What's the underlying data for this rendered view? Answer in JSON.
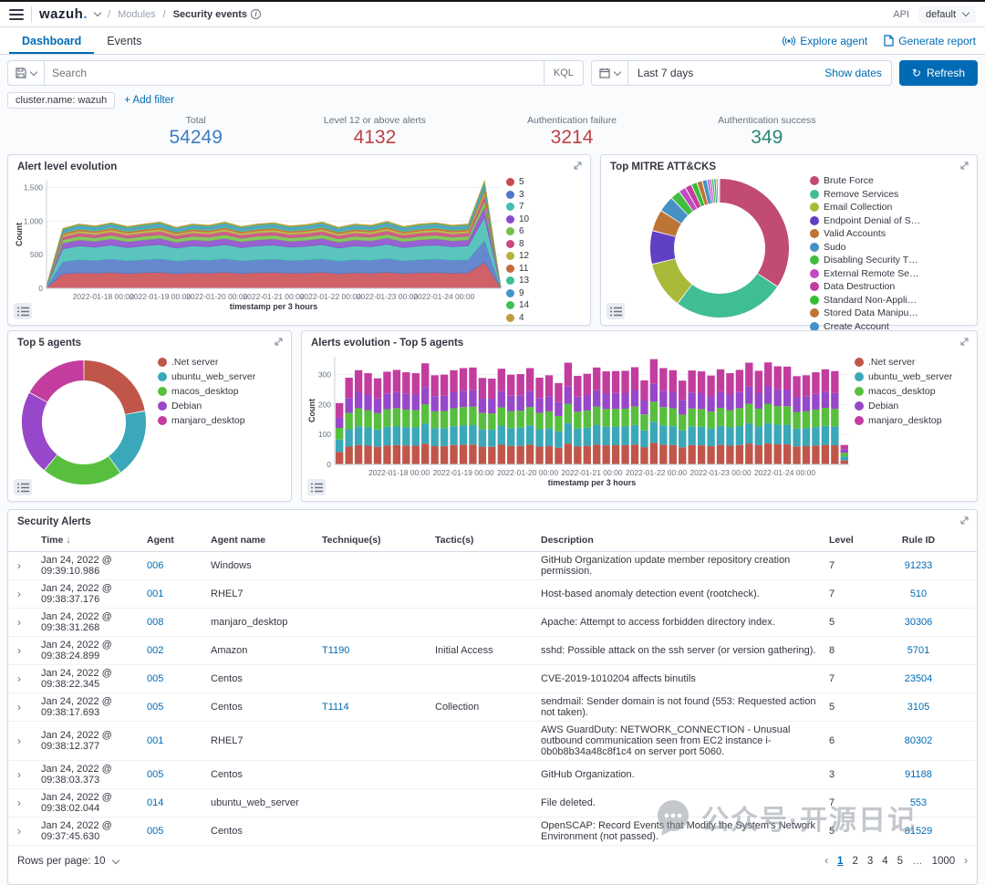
{
  "navbar": {
    "logo": "wazuh",
    "logo_dot": ".",
    "breadcrumb_section": "Modules",
    "breadcrumb_page": "Security events",
    "api_label": "API",
    "api_value": "default"
  },
  "tabs": {
    "dashboard": "Dashboard",
    "events": "Events",
    "explore_agent": "Explore agent",
    "generate_report": "Generate report"
  },
  "toolbar": {
    "search_placeholder": "Search",
    "kql_label": "KQL",
    "date_value": "Last 7 days",
    "show_dates": "Show dates",
    "refresh": "Refresh"
  },
  "filters": {
    "pill": "cluster.name: wazuh",
    "add_filter": "+ Add filter"
  },
  "stats": [
    {
      "label": "Total",
      "value": "54249",
      "color": "#3e7dbf"
    },
    {
      "label": "Level 12 or above alerts",
      "value": "4132",
      "color": "#bd4045"
    },
    {
      "label": "Authentication failure",
      "value": "3214",
      "color": "#bd4045"
    },
    {
      "label": "Authentication success",
      "value": "349",
      "color": "#2d8677"
    }
  ],
  "chart_data": [
    {
      "id": "alert-level-evolution",
      "type": "area",
      "title": "Alert level evolution",
      "xlabel": "timestamp per 3 hours",
      "ylabel": "Count",
      "ylim": [
        0,
        1600
      ],
      "yticks": [
        0,
        500,
        1000,
        1500
      ],
      "xticks": [
        "2022-01-18 00:00",
        "2022-01-19 00:00",
        "2022-01-20 00:00",
        "2022-01-21 00:00",
        "2022-01-22 00:00",
        "2022-01-23 00:00",
        "2022-01-24 00:00"
      ],
      "profile": [
        0.04,
        0.93,
        1.0,
        0.97,
        1.02,
        0.96,
        1.0,
        1.03,
        0.95,
        1.0,
        0.98,
        1.03,
        0.96,
        1.0,
        1.02,
        0.97,
        0.99,
        1.03,
        0.95,
        1.0,
        0.98,
        1.04,
        0.96,
        1.0,
        1.02,
        0.98,
        1.0,
        1.68,
        0.03
      ],
      "series": [
        {
          "name": "5",
          "base": 230,
          "color": "#ca4b52"
        },
        {
          "name": "3",
          "base": 195,
          "color": "#5077c7"
        },
        {
          "name": "7",
          "base": 205,
          "color": "#44bdb4"
        },
        {
          "name": "10",
          "base": 90,
          "color": "#8a4bcb"
        },
        {
          "name": "6",
          "base": 55,
          "color": "#76bf4a"
        },
        {
          "name": "8",
          "base": 48,
          "color": "#c9497e"
        },
        {
          "name": "12",
          "base": 30,
          "color": "#b5b33c"
        },
        {
          "name": "11",
          "base": 24,
          "color": "#c46b3a"
        },
        {
          "name": "13",
          "base": 20,
          "color": "#3fbf8e"
        },
        {
          "name": "9",
          "base": 38,
          "color": "#4596c9"
        },
        {
          "name": "14",
          "base": 12,
          "color": "#3fbf55"
        },
        {
          "name": "4",
          "base": 10,
          "color": "#bf9c3f"
        }
      ]
    },
    {
      "id": "top-mitre-attacks",
      "type": "pie",
      "title": "Top MITRE ATT&CKS",
      "slices": [
        {
          "label": "Brute Force",
          "value": 33,
          "color": "#c14b71"
        },
        {
          "label": "Remove Services",
          "value": 25,
          "color": "#41bd96"
        },
        {
          "label": "Email Collection",
          "value": 10.5,
          "color": "#a9b93a"
        },
        {
          "label": "Endpoint Denial of S…",
          "value": 7.5,
          "color": "#6041c4"
        },
        {
          "label": "Valid Accounts",
          "value": 4.8,
          "color": "#bd7435"
        },
        {
          "label": "Sudo",
          "value": 3.6,
          "color": "#4590c4"
        },
        {
          "label": "Disabling Security T…",
          "value": 2.2,
          "color": "#41bd41"
        },
        {
          "label": "External Remote Se…",
          "value": 1.6,
          "color": "#c24bc2"
        },
        {
          "label": "Data Destruction",
          "value": 1.5,
          "color": "#c23da0"
        },
        {
          "label": "Standard Non-Appli…",
          "value": 1.3,
          "color": "#35bd35"
        },
        {
          "label": "Stored Data Manipu…",
          "value": 1.2,
          "color": "#bd7435"
        },
        {
          "label": "Create Account",
          "value": 1.1,
          "color": "#4590c4"
        },
        {
          "label": "other",
          "value": 0.5,
          "color": "#8a4bcb",
          "in_legend": false
        },
        {
          "label": "other",
          "value": 0.5,
          "color": "#c24bc2",
          "in_legend": false
        },
        {
          "label": "other",
          "value": 0.5,
          "color": "#35bd35",
          "in_legend": false
        },
        {
          "label": "other",
          "value": 0.5,
          "color": "#4590c4",
          "in_legend": false
        },
        {
          "label": "other",
          "value": 0.4,
          "color": "#bd7435",
          "in_legend": false
        },
        {
          "label": "other",
          "value": 0.4,
          "color": "#d3dae6",
          "in_legend": false
        }
      ]
    },
    {
      "id": "top-5-agents",
      "type": "pie",
      "title": "Top 5 agents",
      "slices": [
        {
          "label": ".Net server",
          "value": 22,
          "color": "#c0564a"
        },
        {
          "label": "ubuntu_web_server",
          "value": 18,
          "color": "#3aa8b8"
        },
        {
          "label": "macos_desktop",
          "value": 21,
          "color": "#58bf3e"
        },
        {
          "label": "Debian",
          "value": 22,
          "color": "#9747c9"
        },
        {
          "label": "manjaro_desktop",
          "value": 17,
          "color": "#c23d9e"
        }
      ]
    },
    {
      "id": "alerts-evolution-top-5-agents",
      "type": "bar",
      "title": "Alerts evolution - Top 5 agents",
      "xlabel": "timestamp per 3 hours",
      "ylabel": "Count",
      "ylim": [
        0,
        360
      ],
      "yticks": [
        0,
        100,
        200,
        300
      ],
      "xticks": [
        "2022-01-18 00:00",
        "2022-01-19 00:00",
        "2022-01-20 00:00",
        "2022-01-21 00:00",
        "2022-01-22 00:00",
        "2022-01-23 00:00",
        "2022-01-24 00:00"
      ],
      "totals": [
        205,
        290,
        315,
        305,
        288,
        310,
        316,
        308,
        305,
        338,
        298,
        300,
        315,
        322,
        324,
        289,
        287,
        320,
        300,
        302,
        322,
        290,
        298,
        272,
        340,
        296,
        303,
        324,
        311,
        312,
        313,
        325,
        281,
        352,
        322,
        315,
        280,
        314,
        311,
        297,
        318,
        305,
        316,
        340,
        313,
        341,
        328,
        327,
        295,
        298,
        308,
        318,
        312,
        65
      ],
      "series": [
        {
          "name": ".Net server",
          "share": 0.205,
          "color": "#c0564a"
        },
        {
          "name": "ubuntu_web_server",
          "share": 0.2,
          "color": "#3aa8b8"
        },
        {
          "name": "macos_desktop",
          "share": 0.19,
          "color": "#58bf3e"
        },
        {
          "name": "Debian",
          "share": 0.17,
          "color": "#9747c9"
        },
        {
          "name": "manjaro_desktop",
          "share": 0.235,
          "color": "#c23d9e"
        }
      ]
    }
  ],
  "table": {
    "title": "Security Alerts",
    "columns": [
      "Time",
      "Agent",
      "Agent name",
      "Technique(s)",
      "Tactic(s)",
      "Description",
      "Level",
      "Rule ID"
    ],
    "rows": [
      {
        "time": "Jan 24, 2022 @ 09:39:10.986",
        "agent": "006",
        "agent_name": "Windows",
        "technique": "",
        "tactic": "",
        "description": "GitHub Organization update member repository creation permission.",
        "level": "7",
        "rule_id": "91233"
      },
      {
        "time": "Jan 24, 2022 @ 09:38:37.176",
        "agent": "001",
        "agent_name": "RHEL7",
        "technique": "",
        "tactic": "",
        "description": "Host-based anomaly detection event (rootcheck).",
        "level": "7",
        "rule_id": "510"
      },
      {
        "time": "Jan 24, 2022 @ 09:38:31.268",
        "agent": "008",
        "agent_name": "manjaro_desktop",
        "technique": "",
        "tactic": "",
        "description": "Apache: Attempt to access forbidden directory index.",
        "level": "5",
        "rule_id": "30306"
      },
      {
        "time": "Jan 24, 2022 @ 09:38:24.899",
        "agent": "002",
        "agent_name": "Amazon",
        "technique": "T1190",
        "tactic": "Initial Access",
        "description": "sshd: Possible attack on the ssh server (or version gathering).",
        "level": "8",
        "rule_id": "5701"
      },
      {
        "time": "Jan 24, 2022 @ 09:38:22.345",
        "agent": "005",
        "agent_name": "Centos",
        "technique": "",
        "tactic": "",
        "description": "CVE-2019-1010204 affects binutils",
        "level": "7",
        "rule_id": "23504"
      },
      {
        "time": "Jan 24, 2022 @ 09:38:17.693",
        "agent": "005",
        "agent_name": "Centos",
        "technique": "T1114",
        "tactic": "Collection",
        "description": "sendmail: Sender domain is not found (553: Requested action not taken).",
        "level": "5",
        "rule_id": "3105"
      },
      {
        "time": "Jan 24, 2022 @ 09:38:12.377",
        "agent": "001",
        "agent_name": "RHEL7",
        "technique": "",
        "tactic": "",
        "description": "AWS GuardDuty: NETWORK_CONNECTION - Unusual outbound communication seen from EC2 instance i-0b0b8b34a48c8f1c4 on server port 5060.",
        "level": "6",
        "rule_id": "80302"
      },
      {
        "time": "Jan 24, 2022 @ 09:38:03.373",
        "agent": "005",
        "agent_name": "Centos",
        "technique": "",
        "tactic": "",
        "description": "GitHub Organization.",
        "level": "3",
        "rule_id": "91188"
      },
      {
        "time": "Jan 24, 2022 @ 09:38:02.044",
        "agent": "014",
        "agent_name": "ubuntu_web_server",
        "technique": "",
        "tactic": "",
        "description": "File deleted.",
        "level": "7",
        "rule_id": "553"
      },
      {
        "time": "Jan 24, 2022 @ 09:37:45.630",
        "agent": "005",
        "agent_name": "Centos",
        "technique": "",
        "tactic": "",
        "description": "OpenSCAP: Record Events that Modify the System's Network Environment (not passed).",
        "level": "5",
        "rule_id": "81529"
      }
    ]
  },
  "footer": {
    "rows_per_page_label": "Rows per page: 10",
    "pages": [
      "1",
      "2",
      "3",
      "4",
      "5",
      "…",
      "1000"
    ],
    "active_page": "1",
    "prev": "‹",
    "next": "›"
  },
  "watermark": {
    "text": "公众号·开源日记"
  }
}
